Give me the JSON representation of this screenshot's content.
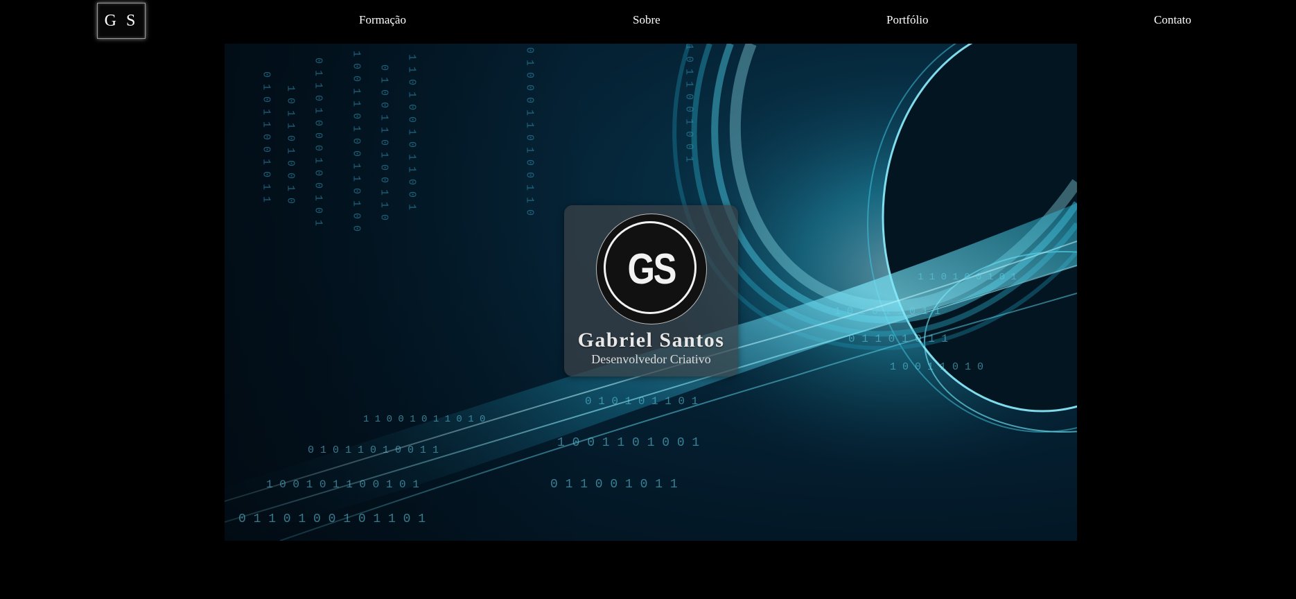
{
  "header": {
    "logo_text": "G S",
    "nav": [
      {
        "label": "Formação"
      },
      {
        "label": "Sobre"
      },
      {
        "label": "Portfólio"
      },
      {
        "label": "Contato"
      }
    ]
  },
  "hero": {
    "avatar_monogram": "GS",
    "name": "Gabriel Santos",
    "role": "Desenvolvedor Criativo",
    "colors": {
      "background": "#000000",
      "accent": "#3fd6ee",
      "card": "#3c4248"
    }
  }
}
